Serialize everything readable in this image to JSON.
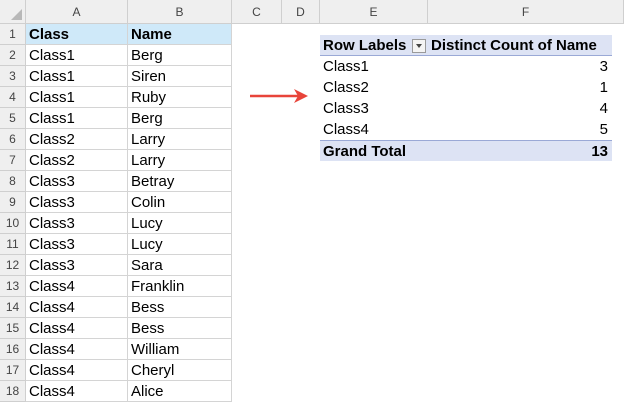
{
  "columns": [
    "A",
    "B",
    "C",
    "D",
    "E",
    "F"
  ],
  "rows": [
    "1",
    "2",
    "3",
    "4",
    "5",
    "6",
    "7",
    "8",
    "9",
    "10",
    "11",
    "12",
    "13",
    "14",
    "15",
    "16",
    "17",
    "18"
  ],
  "table": {
    "headers": [
      "Class",
      "Name"
    ],
    "data": [
      [
        "Class1",
        "Berg"
      ],
      [
        "Class1",
        "Siren"
      ],
      [
        "Class1",
        "Ruby"
      ],
      [
        "Class1",
        "Berg"
      ],
      [
        "Class2",
        "Larry"
      ],
      [
        "Class2",
        "Larry"
      ],
      [
        "Class3",
        "Betray"
      ],
      [
        "Class3",
        "Colin"
      ],
      [
        "Class3",
        "Lucy"
      ],
      [
        "Class3",
        "Lucy"
      ],
      [
        "Class3",
        "Sara"
      ],
      [
        "Class4",
        "Franklin"
      ],
      [
        "Class4",
        "Bess"
      ],
      [
        "Class4",
        "Bess"
      ],
      [
        "Class4",
        "William"
      ],
      [
        "Class4",
        "Cheryl"
      ],
      [
        "Class4",
        "Alice"
      ]
    ]
  },
  "pivot": {
    "row_labels_header": "Row Labels",
    "value_header": "Distinct Count of Name",
    "rows": [
      {
        "label": "Class1",
        "value": "3"
      },
      {
        "label": "Class2",
        "value": "1"
      },
      {
        "label": "Class3",
        "value": "4"
      },
      {
        "label": "Class4",
        "value": "5"
      }
    ],
    "total_label": "Grand Total",
    "total_value": "13"
  },
  "icons": {
    "arrow": "right-arrow-icon",
    "filter": "filter-dropdown-icon"
  },
  "colors": {
    "header_fill": "#cfe9f9",
    "pivot_fill": "#dde3f4",
    "arrow": "#e8443a"
  }
}
